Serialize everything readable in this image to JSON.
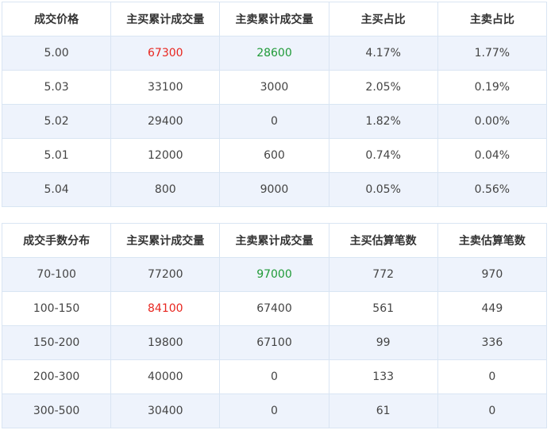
{
  "colors": {
    "up": "#e8261f",
    "down": "#1f9a37",
    "row_alt_bg": "#eef3fc",
    "border": "#d9e5f3"
  },
  "price_table": {
    "headers": [
      "成交价格",
      "主买累计成交量",
      "主卖累计成交量",
      "主买占比",
      "主卖占比"
    ],
    "rows": [
      [
        "5.00",
        "67300",
        "28600",
        "4.17%",
        "1.77%"
      ],
      [
        "5.03",
        "33100",
        "3000",
        "2.05%",
        "0.19%"
      ],
      [
        "5.02",
        "29400",
        "0",
        "1.82%",
        "0.00%"
      ],
      [
        "5.01",
        "12000",
        "600",
        "0.74%",
        "0.04%"
      ],
      [
        "5.04",
        "800",
        "9000",
        "0.05%",
        "0.56%"
      ]
    ]
  },
  "lot_table": {
    "headers": [
      "成交手数分布",
      "主买累计成交量",
      "主卖累计成交量",
      "主买估算笔数",
      "主卖估算笔数"
    ],
    "rows": [
      [
        "70-100",
        "77200",
        "97000",
        "772",
        "970"
      ],
      [
        "100-150",
        "84100",
        "67400",
        "561",
        "449"
      ],
      [
        "150-200",
        "19800",
        "67100",
        "99",
        "336"
      ],
      [
        "200-300",
        "40000",
        "0",
        "133",
        "0"
      ],
      [
        "300-500",
        "30400",
        "0",
        "61",
        "0"
      ]
    ]
  }
}
